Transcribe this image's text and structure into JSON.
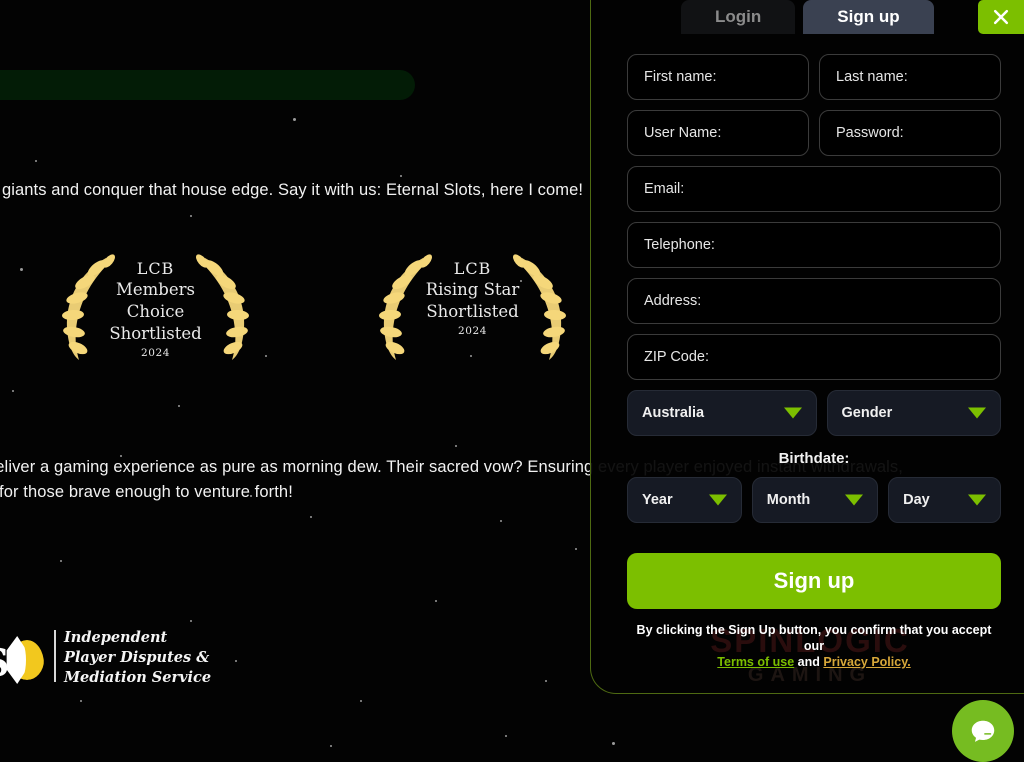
{
  "background": {
    "paragraph_1": "n giants and conquer that house edge. Say it with us: Eternal Slots, here I come!",
    "paragraph_2_line_1": "deliver a gaming experience as pure as morning dew. Their sacred vow? Ensuring every player enjoyed instant withdrawals,",
    "paragraph_2_line_2": "s for those brave enough to venture forth!",
    "awards": [
      {
        "org": "LCB",
        "line1": "Members Choice",
        "line2": "Shortlisted",
        "year": "2024"
      },
      {
        "org": "LCB",
        "line1": "Rising Star",
        "line2": "Shortlisted",
        "year": "2024"
      }
    ],
    "ibas": {
      "mark_text": "S",
      "line1": "Independent",
      "line2": "Player Disputes &",
      "line3": "Mediation Service"
    }
  },
  "modal": {
    "watermark": {
      "main": "SPINLOGIC",
      "sub": "GAMING"
    },
    "tabs": [
      {
        "id": "login",
        "label": "Login",
        "active": false
      },
      {
        "id": "signup",
        "label": "Sign up",
        "active": true
      }
    ],
    "close_label": "close-icon",
    "fields": [
      {
        "id": "first_name",
        "label": "First name:",
        "value": "",
        "width": "half"
      },
      {
        "id": "last_name",
        "label": "Last name:",
        "value": "",
        "width": "half"
      },
      {
        "id": "user_name",
        "label": "User Name:",
        "value": "",
        "width": "half"
      },
      {
        "id": "password",
        "label": "Password:",
        "value": "",
        "width": "half"
      },
      {
        "id": "email",
        "label": "Email:",
        "value": "",
        "width": "full"
      },
      {
        "id": "telephone",
        "label": "Telephone:",
        "value": "",
        "width": "full"
      },
      {
        "id": "address",
        "label": "Address:",
        "value": "",
        "width": "full"
      },
      {
        "id": "zip_code",
        "label": "ZIP Code:",
        "value": "",
        "width": "full"
      }
    ],
    "selects": {
      "country": "Australia",
      "gender": "Gender",
      "year": "Year",
      "month": "Month",
      "day": "Day"
    },
    "birthdate_label": "Birthdate:",
    "submit_label": "Sign up",
    "terms": {
      "prefix": "By clicking the Sign Up button, you confirm that you accept our",
      "terms_link": "Terms of use",
      "conjunction": "and",
      "privacy_link": "Privacy Policy."
    }
  },
  "chat": {
    "label": "chat-bubble-icon"
  },
  "colors": {
    "accent_green": "#7cbf00",
    "chat_green": "#76bc21",
    "tab_active": "#3a4151",
    "select_bg": "#161a24",
    "privacy_link": "#d8a83a",
    "modal_border": "#4e6a12",
    "gold": "#f2c81e"
  }
}
